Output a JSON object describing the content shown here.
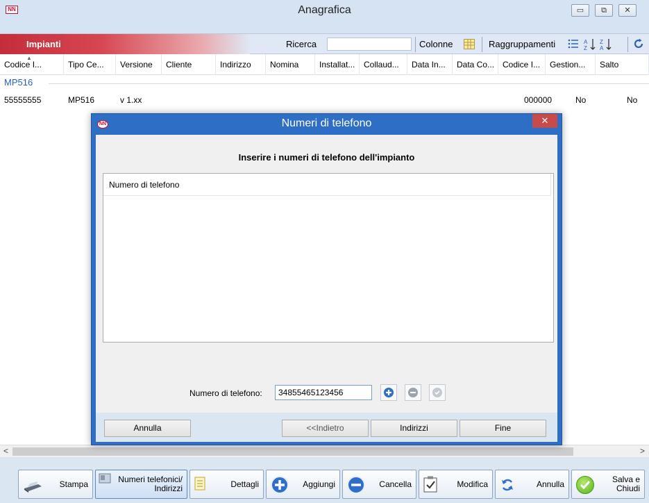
{
  "window": {
    "logo": "NN",
    "title": "Anagrafica",
    "minimize": "▭",
    "maximize": "⧉",
    "close": "✕"
  },
  "toolbar": {
    "tab_label": "Impianti",
    "search_label": "Ricerca",
    "search_value": "",
    "columns_label": "Colonne",
    "grouping_label": "Raggruppamenti"
  },
  "grid": {
    "columns": [
      "Codice I...",
      "Tipo Ce...",
      "Versione",
      "Cliente",
      "Indirizzo",
      "Nomina",
      "Installat...",
      "Collaud...",
      "Data In...",
      "Data Co...",
      "Codice I...",
      "Gestion...",
      "Salto"
    ],
    "group": "MP516",
    "row": {
      "codice": "55555555",
      "tipo": "MP516",
      "versione": "v 1.xx",
      "codice2": "000000",
      "gestione": "No",
      "salto": "No"
    }
  },
  "scroll": {
    "left_arrow": "<",
    "right_arrow": ">"
  },
  "bottom": {
    "stampa": "Stampa",
    "numeri_line1": "Numeri telefonici/",
    "numeri_line2": "Indirizzi",
    "dettagli": "Dettagli",
    "aggiungi": "Aggiungi",
    "cancella": "Cancella",
    "modifica": "Modifica",
    "annulla": "Annulla",
    "salva_line1": "Salva e",
    "salva_line2": "Chiudi"
  },
  "dialog": {
    "logo": "NN",
    "title": "Numeri di telefono",
    "close": "✕",
    "heading": "Inserire i numeri di telefono dell'impianto",
    "list_header": "Numero di telefono",
    "phone_label": "Numero di telefono:",
    "phone_value": "34855465123456",
    "buttons": {
      "annulla": "Annulla",
      "indietro": "<<Indietro",
      "indirizzi": "Indirizzi",
      "fine": "Fine"
    }
  },
  "colors": {
    "accent_red": "#c42d3a",
    "dialog_blue": "#2e6fc5",
    "group_blue": "#2a62b5"
  }
}
